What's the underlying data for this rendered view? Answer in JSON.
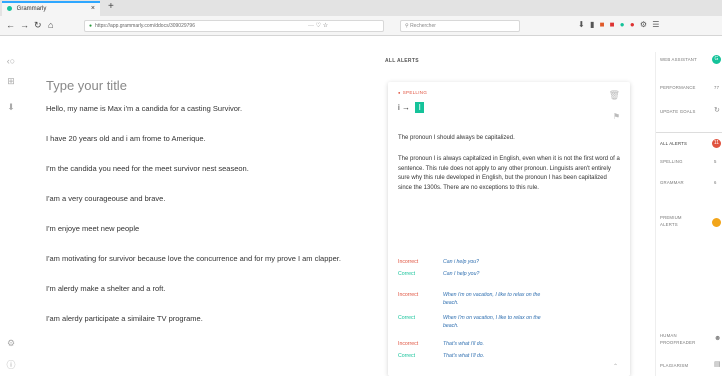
{
  "browser": {
    "tab_title": "Grammarly",
    "tab_close": "×",
    "new_tab": "+",
    "url": "https://app.grammarly.com/ddocs/309029796",
    "url_actions": "··· ♡ ☆",
    "search_placeholder": "Rechercher"
  },
  "document": {
    "title_placeholder": "Type your title",
    "paragraphs": [
      "Hello, my name is Max i'm a candida for a casting Survivor.",
      "I have 20 years old and i am frome to Amerique.",
      "I'm the candida you need for the meet survivor nest seaseon.",
      "I'am a very courageouse and brave.",
      "I'm enjoye meet new people",
      "I'am motivating for survivor because love the concurrence and for my prove I am clapper.",
      "I'm alerdy make a shelter and a roft.",
      "I'am alerdy participate a similaire TV programe."
    ]
  },
  "alerts": {
    "heading": "ALL ALERTS",
    "card": {
      "category": "SPELLING",
      "original": "i",
      "arrow": "→",
      "replacement": "I",
      "summary": "The pronoun I should always be capitalized.",
      "explanation": "The pronoun I is always capitalized in English, even when it is not the first word of a sentence. This rule does not apply to any other pronoun. Linguists aren't entirely sure why this rule developed in English, but the pronoun I has been capitalized since the 1300s. There are no exceptions to this rule.",
      "examples": [
        {
          "label": "Incorrect",
          "text": "Can i help you?"
        },
        {
          "label": "Correct",
          "text": "Can I help you?"
        },
        {
          "label": "Incorrect",
          "text": "When i'm on vacation, I like to relax on the beach."
        },
        {
          "label": "Correct",
          "text": "When I'm on vacation, I like to relax on the beach."
        },
        {
          "label": "Incorrect",
          "text": "That's what i'll do."
        },
        {
          "label": "Correct",
          "text": "That's what I'll do."
        }
      ]
    }
  },
  "sidebar": {
    "goals": "WEB ASSISTANT",
    "performance": "PERFORMANCE",
    "update_goals": "UPDATE GOALS",
    "all_alerts": "ALL ALERTS",
    "spelling": "SPELLING",
    "grammar": "GRAMMAR",
    "premium_alerts": "PREMIUM ALERTS",
    "human_proofreader": "HUMAN PROOFREADER",
    "plagiarism": "PLAGIARISM",
    "performance_score": "77",
    "all_alerts_count": "11",
    "spelling_count": "5",
    "grammar_count": "6"
  },
  "colors": {
    "brand_green": "#15c39a",
    "error_red": "#e0533f",
    "example_blue": "#2f6fb0"
  }
}
